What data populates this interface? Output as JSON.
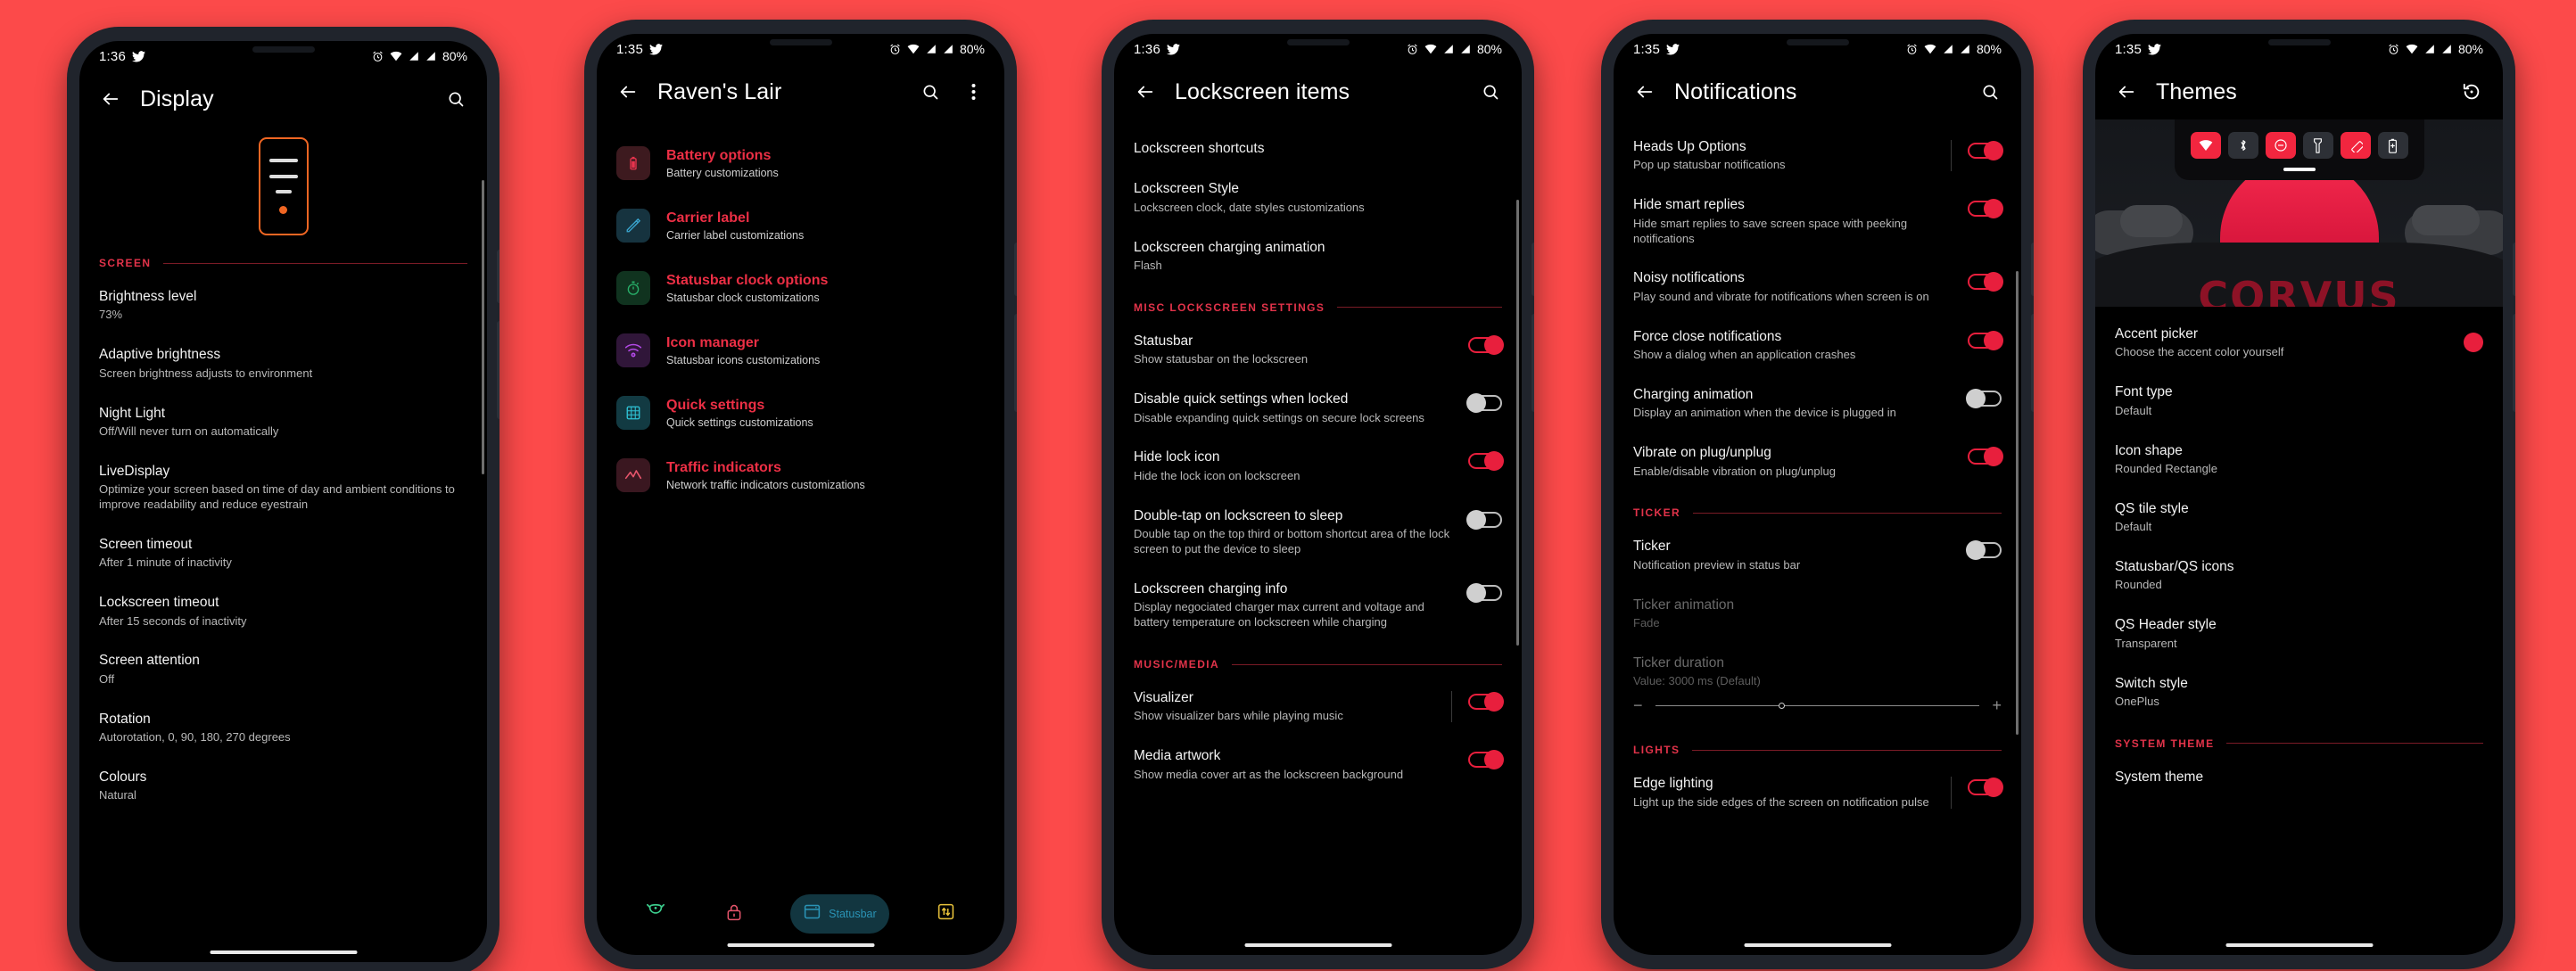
{
  "theme": {
    "wallpaper": "#fc4a4a",
    "accent": "#e81f3d",
    "link": "#ec2f45",
    "orange": "#f06623"
  },
  "phones": [
    {
      "id": "display",
      "status": {
        "time": "1:36",
        "battery": "80%",
        "icons": [
          "twitter-icon",
          "alarm-icon",
          "wifi-icon",
          "signal-icon",
          "signal-icon"
        ]
      },
      "appbar": {
        "title": "Display",
        "back": "←",
        "actions": [
          "search-icon"
        ]
      },
      "sections": [
        {
          "label": "SCREEN"
        }
      ],
      "items": [
        {
          "title": "Brightness level",
          "sub": "73%"
        },
        {
          "title": "Adaptive brightness",
          "sub": "Screen brightness adjusts to environment"
        },
        {
          "title": "Night Light",
          "sub": "Off/Will never turn on automatically"
        },
        {
          "title": "LiveDisplay",
          "sub": "Optimize your screen based on time of day and ambient conditions to improve readability and reduce eyestrain"
        },
        {
          "title": "Screen timeout",
          "sub": "After 1 minute of inactivity"
        },
        {
          "title": "Lockscreen timeout",
          "sub": "After 15 seconds of inactivity"
        },
        {
          "title": "Screen attention",
          "sub": "Off"
        },
        {
          "title": "Rotation",
          "sub": "Autorotation, 0, 90, 180, 270 degrees"
        },
        {
          "title": "Colours",
          "sub": "Natural"
        }
      ]
    },
    {
      "id": "ravens-lair",
      "status": {
        "time": "1:35",
        "battery": "80%"
      },
      "appbar": {
        "title": "Raven's Lair",
        "back": "←",
        "actions": [
          "search-icon",
          "overflow-icon"
        ]
      },
      "items": [
        {
          "title": "Battery options",
          "sub": "Battery customizations",
          "icon": "battery-icon",
          "iconColor": "#e8344e",
          "iconBg": "#3d1a1f"
        },
        {
          "title": "Carrier label",
          "sub": "Carrier label customizations",
          "icon": "pencil-icon",
          "iconColor": "#3aa6d0",
          "iconBg": "#16333f"
        },
        {
          "title": "Statusbar clock options",
          "sub": "Statusbar clock customizations",
          "icon": "stopwatch-icon",
          "iconColor": "#28b06a",
          "iconBg": "#10331f"
        },
        {
          "title": "Icon manager",
          "sub": "Statusbar icons customizations",
          "icon": "wifi-icon",
          "iconColor": "#b44ae8",
          "iconBg": "#301639"
        },
        {
          "title": "Quick settings",
          "sub": "Quick settings customizations",
          "icon": "grid-icon",
          "iconColor": "#2fc3d6",
          "iconBg": "#123a42"
        },
        {
          "title": "Traffic indicators",
          "sub": "Network traffic indicators customizations",
          "icon": "chart-icon",
          "iconColor": "#e8556c",
          "iconBg": "#3a1720"
        }
      ],
      "bottomnav": [
        {
          "label": "",
          "icon": "raven-icon",
          "color": "#3ccf8e",
          "active": false
        },
        {
          "label": "",
          "icon": "lock-icon",
          "color": "#e8556c",
          "active": false
        },
        {
          "label": "Statusbar",
          "icon": "statusbar-icon",
          "color": "#2a93b5",
          "active": true
        },
        {
          "label": "",
          "icon": "sliders-icon",
          "color": "#e8c23a",
          "active": false
        }
      ]
    },
    {
      "id": "lockscreen-items",
      "status": {
        "time": "1:36",
        "battery": "80%"
      },
      "appbar": {
        "title": "Lockscreen items",
        "back": "←",
        "actions": [
          "search-icon"
        ]
      },
      "items": [
        {
          "title": "Lockscreen shortcuts",
          "sub": ""
        },
        {
          "title": "Lockscreen Style",
          "sub": "Lockscreen clock, date styles customizations"
        },
        {
          "title": "Lockscreen charging animation",
          "sub": "Flash"
        },
        {
          "section": "MISC LOCKSCREEN SETTINGS"
        },
        {
          "title": "Statusbar",
          "sub": "Show statusbar on the lockscreen",
          "toggle": "on"
        },
        {
          "title": "Disable quick settings when locked",
          "sub": "Disable expanding quick settings on secure lock screens",
          "toggle": "off"
        },
        {
          "title": "Hide lock icon",
          "sub": "Hide the lock icon on lockscreen",
          "toggle": "on"
        },
        {
          "title": "Double-tap on lockscreen to sleep",
          "sub": "Double tap on the top third or bottom shortcut area of the lock screen to put the device to sleep",
          "toggle": "off"
        },
        {
          "title": "Lockscreen charging info",
          "sub": "Display negociated charger max current and voltage and battery temperature on lockscreen while charging",
          "toggle": "off"
        },
        {
          "section": "MUSIC/MEDIA"
        },
        {
          "title": "Visualizer",
          "sub": "Show visualizer bars while playing music",
          "toggle": "on",
          "divider": true
        },
        {
          "title": "Media artwork",
          "sub": "Show media cover art as the lockscreen background",
          "toggle": "on"
        }
      ]
    },
    {
      "id": "notifications",
      "status": {
        "time": "1:35",
        "battery": "80%"
      },
      "appbar": {
        "title": "Notifications",
        "back": "←",
        "actions": [
          "search-icon"
        ]
      },
      "items": [
        {
          "title": "Heads Up Options",
          "sub": "Pop up statusbar notifications",
          "toggle": "on",
          "divider": true
        },
        {
          "title": "Hide smart replies",
          "sub": "Hide smart replies to save screen space with peeking notifications",
          "toggle": "on"
        },
        {
          "title": "Noisy notifications",
          "sub": "Play sound and vibrate for notifications when screen is on",
          "toggle": "on"
        },
        {
          "title": "Force close notifications",
          "sub": "Show a dialog when an application crashes",
          "toggle": "on"
        },
        {
          "title": "Charging animation",
          "sub": "Display an animation when the device is plugged in",
          "toggle": "off"
        },
        {
          "title": "Vibrate on plug/unplug",
          "sub": "Enable/disable vibration on plug/unplug",
          "toggle": "on"
        },
        {
          "section": "TICKER"
        },
        {
          "title": "Ticker",
          "sub": "Notification preview in status bar",
          "toggle": "off"
        },
        {
          "title": "Ticker animation",
          "sub": "Fade",
          "dim": true
        },
        {
          "title": "Ticker duration",
          "sub": "Value: 3000 ms (Default)",
          "dim": true,
          "slider": true
        },
        {
          "section": "LIGHTS"
        },
        {
          "title": "Edge lighting",
          "sub": "Light up the side edges of the screen on notification pulse",
          "toggle": "on",
          "divider": true
        }
      ],
      "slider": {
        "minus": "−",
        "plus": "+",
        "position": "38%"
      }
    },
    {
      "id": "themes",
      "status": {
        "time": "1:35",
        "battery": "80%"
      },
      "appbar": {
        "title": "Themes",
        "back": "←",
        "actions": [
          "history-restore-icon"
        ]
      },
      "hero": {
        "wordmark": "CORVUS",
        "tiles": [
          {
            "icon": "wifi-icon",
            "state": "on"
          },
          {
            "icon": "bluetooth-icon",
            "state": "off"
          },
          {
            "icon": "dnd-icon",
            "state": "on"
          },
          {
            "icon": "flashlight-icon",
            "state": "off"
          },
          {
            "icon": "auto-rotate-icon",
            "state": "on"
          },
          {
            "icon": "battery-saver-icon",
            "state": "off"
          }
        ]
      },
      "items": [
        {
          "title": "Accent picker",
          "sub": "Choose the accent color yourself",
          "swatch": "#e81f3d"
        },
        {
          "title": "Font type",
          "sub": "Default"
        },
        {
          "title": "Icon shape",
          "sub": "Rounded Rectangle"
        },
        {
          "title": "QS tile style",
          "sub": "Default"
        },
        {
          "title": "Statusbar/QS icons",
          "sub": "Rounded"
        },
        {
          "title": "QS Header style",
          "sub": "Transparent"
        },
        {
          "title": "Switch style",
          "sub": "OnePlus"
        },
        {
          "section": "SYSTEM THEME"
        },
        {
          "title": "System theme",
          "sub": ""
        }
      ]
    }
  ]
}
